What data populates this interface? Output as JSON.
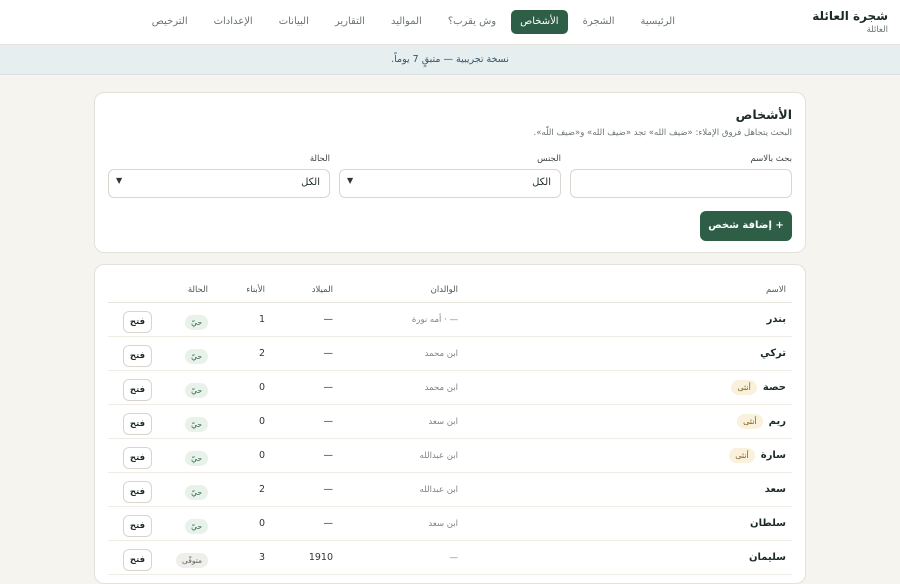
{
  "brand": {
    "title": "شجرة العائلة",
    "subtitle": "العائلة"
  },
  "nav": [
    {
      "label": "الرئيسية",
      "active": false
    },
    {
      "label": "الشجرة",
      "active": false
    },
    {
      "label": "الأشخاص",
      "active": true
    },
    {
      "label": "وش يقرب؟",
      "active": false
    },
    {
      "label": "المواليد",
      "active": false
    },
    {
      "label": "التقارير",
      "active": false
    },
    {
      "label": "البيانات",
      "active": false
    },
    {
      "label": "الإعدادات",
      "active": false
    },
    {
      "label": "الترخيص",
      "active": false
    }
  ],
  "banner": {
    "text": "نسخة تجريبية — متبقٍ 7 يوماً."
  },
  "people": {
    "title": "الأشخاص",
    "hint": "البحث يتجاهل فروق الإملاء: «ضيف الله» تجد «ضيف الله» و«ضيف اللّه».",
    "search_label": "بحث بالاسم",
    "search_value": "",
    "gender_label": "الجنس",
    "gender_value": "الكل",
    "status_label": "الحالة",
    "status_value": "الكل",
    "add_button": "+ إضافة شخص"
  },
  "table": {
    "headers": {
      "name": "الاسم",
      "parents": "الوالدان",
      "birth": "الميلاد",
      "children": "الأبناء",
      "status": "الحالة"
    },
    "rows": [
      {
        "name": "بندر",
        "badge": "",
        "parents": "— · أمه نورة",
        "birth": "—",
        "children": "1",
        "status": "حيّ",
        "action": "فتح"
      },
      {
        "name": "تركي",
        "badge": "",
        "parents": "ابن محمد",
        "birth": "—",
        "children": "2",
        "status": "حيّ",
        "action": "فتح"
      },
      {
        "name": "حصة",
        "badge": "أنثى",
        "parents": "ابن محمد",
        "birth": "—",
        "children": "0",
        "status": "حيّ",
        "action": "فتح"
      },
      {
        "name": "ريم",
        "badge": "أنثى",
        "parents": "ابن سعد",
        "birth": "—",
        "children": "0",
        "status": "حيّ",
        "action": "فتح"
      },
      {
        "name": "سارة",
        "badge": "أنثى",
        "parents": "ابن عبدالله",
        "birth": "—",
        "children": "0",
        "status": "حيّ",
        "action": "فتح"
      },
      {
        "name": "سعد",
        "badge": "",
        "parents": "ابن عبدالله",
        "birth": "—",
        "children": "2",
        "status": "حيّ",
        "action": "فتح"
      },
      {
        "name": "سلطان",
        "badge": "",
        "parents": "ابن سعد",
        "birth": "—",
        "children": "0",
        "status": "حيّ",
        "action": "فتح"
      },
      {
        "name": "سليمان",
        "badge": "",
        "parents": "—",
        "birth": "1910",
        "children": "3",
        "status": "متوفّى",
        "action": "فتح"
      }
    ]
  },
  "colors": {
    "accent": "#2e5e46",
    "banner_bg": "#e7eef0",
    "page_bg": "#f5f4ef"
  }
}
